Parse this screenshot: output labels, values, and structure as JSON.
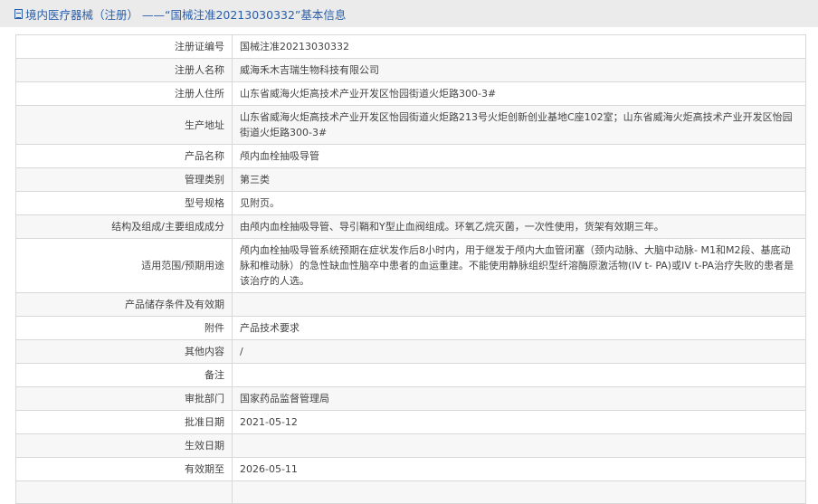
{
  "header": {
    "title": "境内医疗器械（注册） ——“国械注准20213030332”基本信息"
  },
  "rows": [
    {
      "label": "注册证编号",
      "value": "国械注准20213030332"
    },
    {
      "label": "注册人名称",
      "value": "威海禾木吉瑞生物科技有限公司"
    },
    {
      "label": "注册人住所",
      "value": "山东省威海火炬高技术产业开发区怡园街道火炬路300-3#"
    },
    {
      "label": "生产地址",
      "value": "山东省威海火炬高技术产业开发区怡园街道火炬路213号火炬创新创业基地C座102室；山东省威海火炬高技术产业开发区怡园街道火炬路300-3#"
    },
    {
      "label": "产品名称",
      "value": "颅内血栓抽吸导管"
    },
    {
      "label": "管理类别",
      "value": "第三类"
    },
    {
      "label": "型号规格",
      "value": "见附页。"
    },
    {
      "label": "结构及组成/主要组成成分",
      "value": "由颅内血栓抽吸导管、导引鞘和Y型止血阀组成。环氧乙烷灭菌，一次性使用，货架有效期三年。"
    },
    {
      "label": "适用范围/预期用途",
      "value": "颅内血栓抽吸导管系统预期在症状发作后8小时内，用于继发于颅内大血管闭塞（颈内动脉、大脑中动脉- M1和M2段、基底动脉和椎动脉）的急性缺血性脑卒中患者的血运重建。不能使用静脉组织型纤溶酶原激活物(IV t- PA)或IV t-PA治疗失败的患者是该治疗的人选。"
    },
    {
      "label": "产品储存条件及有效期",
      "value": ""
    },
    {
      "label": "附件",
      "value": "产品技术要求"
    },
    {
      "label": "其他内容",
      "value": "/"
    },
    {
      "label": "备注",
      "value": ""
    },
    {
      "label": "审批部门",
      "value": "国家药品监督管理局"
    },
    {
      "label": "批准日期",
      "value": "2021-05-12"
    },
    {
      "label": "生效日期",
      "value": ""
    },
    {
      "label": "有效期至",
      "value": "2026-05-11"
    },
    {
      "label": "",
      "value": ""
    }
  ]
}
